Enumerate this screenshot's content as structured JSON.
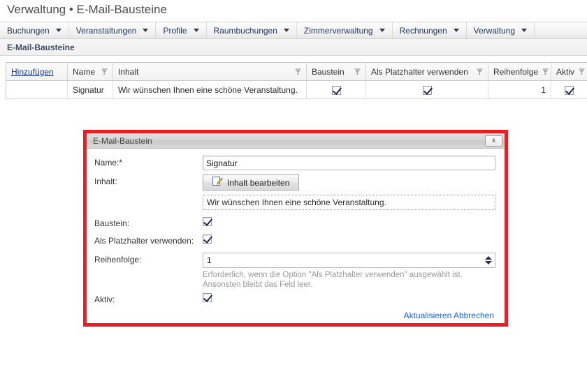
{
  "page": {
    "title": "Verwaltung • E-Mail-Bausteine",
    "breadcrumb": "E-Mail-Bausteine"
  },
  "menubar": {
    "items": [
      {
        "label": "Buchungen"
      },
      {
        "label": "Veranstaltungen"
      },
      {
        "label": "Profile"
      },
      {
        "label": "Raumbuchungen"
      },
      {
        "label": "Zimmerverwaltung"
      },
      {
        "label": "Rechnungen"
      },
      {
        "label": "Verwaltung"
      }
    ]
  },
  "grid": {
    "add_label": "Hinzufügen",
    "columns": [
      {
        "label": "Name",
        "filter": true
      },
      {
        "label": "Inhalt",
        "filter": true
      },
      {
        "label": "Baustein",
        "filter": true
      },
      {
        "label": "Als Platzhalter verwenden",
        "filter": true
      },
      {
        "label": "Reihenfolge",
        "filter": true
      },
      {
        "label": "Aktiv",
        "filter": true
      }
    ],
    "rows": [
      {
        "name": "Signatur",
        "inhalt": "Wir wünschen Ihnen eine schöne Veranstaltung.",
        "baustein": true,
        "platzhalter": true,
        "reihenfolge": "1",
        "aktiv": true
      }
    ]
  },
  "dialog": {
    "title": "E-Mail-Baustein",
    "close_label": "x",
    "fields": {
      "name_label": "Name:",
      "name_required_mark": "*",
      "name_value": "Signatur",
      "inhalt_label": "Inhalt:",
      "edit_button_label": "Inhalt bearbeiten",
      "content_preview": "Wir wünschen Ihnen eine schöne Veranstaltung.",
      "baustein_label": "Baustein:",
      "baustein_checked": true,
      "platzhalter_label": "Als Platzhalter verwenden:",
      "platzhalter_checked": true,
      "reihenfolge_label": "Reihenfolge:",
      "reihenfolge_value": "1",
      "reihenfolge_hint_line1": "Erforderlich, wenn die Option \"Als Platzhalter verwenden\" ausgewählt ist.",
      "reihenfolge_hint_line2": "Ansonsten bleibt das Feld leer.",
      "aktiv_label": "Aktiv:",
      "aktiv_checked": true
    },
    "actions": {
      "update_label": "Aktualisieren",
      "cancel_label": "Abbrechen"
    },
    "highlight_color": "#ee1c25"
  }
}
